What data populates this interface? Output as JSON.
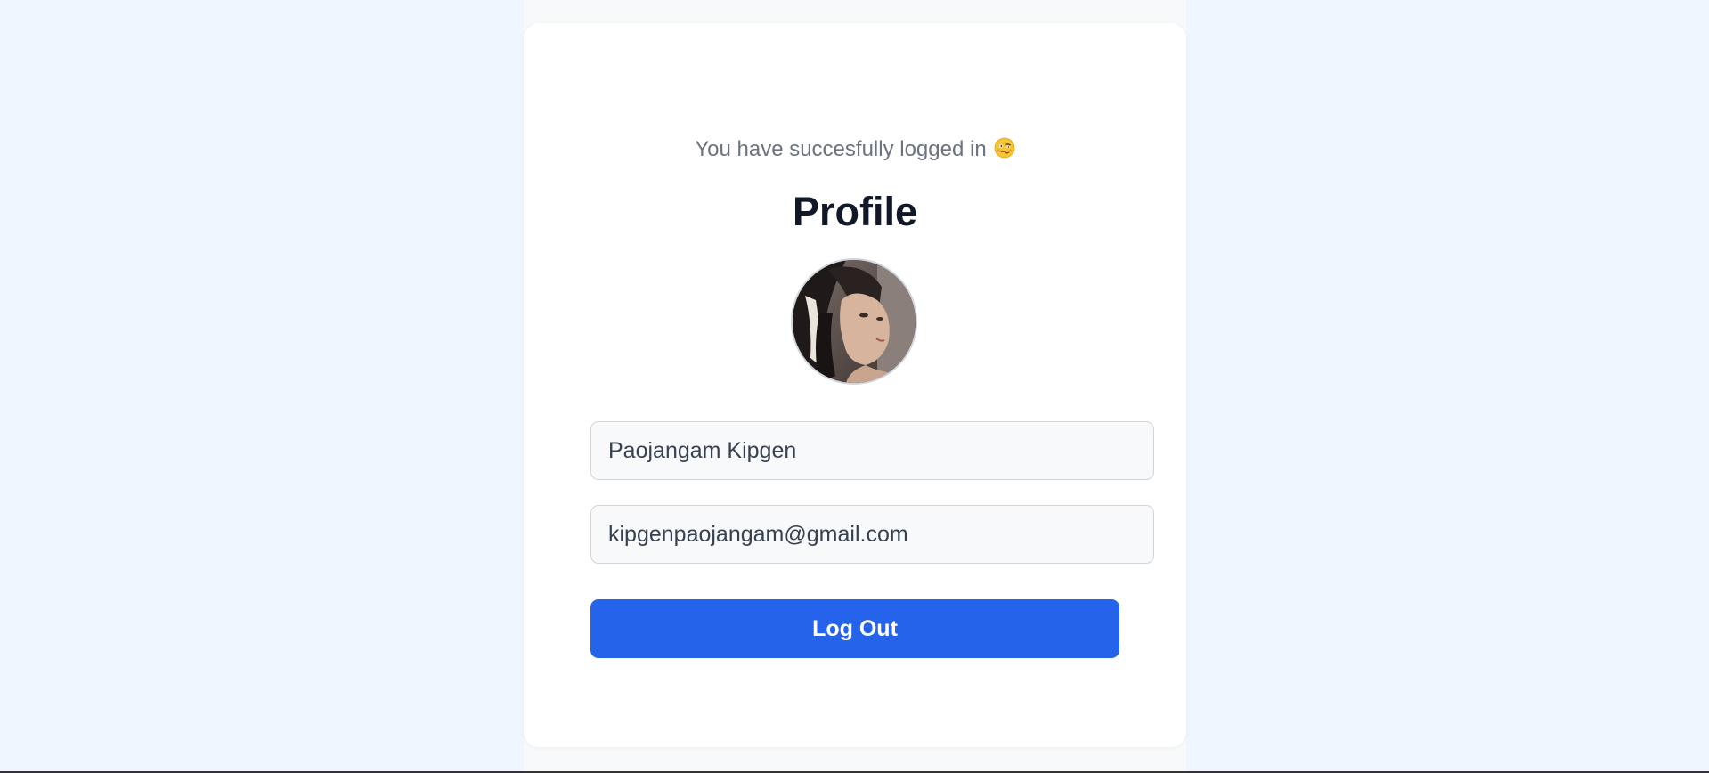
{
  "message": {
    "text": "You have succesfully logged in",
    "emoji_icon": "woozy-face-emoji-icon"
  },
  "profile": {
    "title": "Profile",
    "avatar_icon": "user-avatar-photo"
  },
  "form": {
    "name_value": "Paojangam Kipgen",
    "email_value": "kipgenpaojangam@gmail.com"
  },
  "actions": {
    "logout_label": "Log Out"
  },
  "colors": {
    "background": "#eff6ff",
    "card": "#ffffff",
    "accent": "#2563eb",
    "title": "#111827",
    "muted_text": "#6b7280"
  }
}
